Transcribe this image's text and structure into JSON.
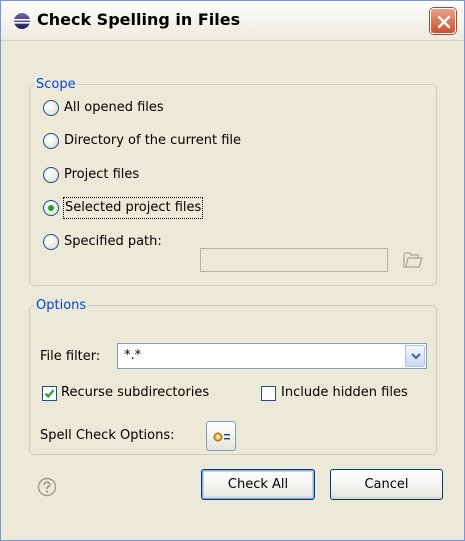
{
  "window": {
    "title": "Check Spelling in Files",
    "icon": "eclipse-icon",
    "close_icon": "close-icon"
  },
  "scope": {
    "legend": "Scope",
    "options": [
      {
        "label": "All opened files",
        "selected": false
      },
      {
        "label": "Directory of the current file",
        "selected": false
      },
      {
        "label": "Project files",
        "selected": false
      },
      {
        "label": "Selected project files",
        "selected": true
      },
      {
        "label": "Specified path:",
        "selected": false
      }
    ],
    "specified_path_value": "",
    "browse_icon": "folder-icon"
  },
  "options": {
    "legend": "Options",
    "file_filter_label": "File filter:",
    "file_filter_value": "*.*",
    "recurse_label": "Recurse subdirectories",
    "recurse_checked": true,
    "hidden_label": "Include hidden files",
    "hidden_checked": false,
    "spell_check_label": "Spell Check Options:",
    "spell_check_icon": "settings-icon"
  },
  "footer": {
    "help_icon": "help-icon",
    "check_all_label": "Check All",
    "cancel_label": "Cancel"
  },
  "colors": {
    "dialog_bg": "#ECE9D8",
    "legend_text": "#0046D5",
    "close_button": "#D0502C"
  }
}
